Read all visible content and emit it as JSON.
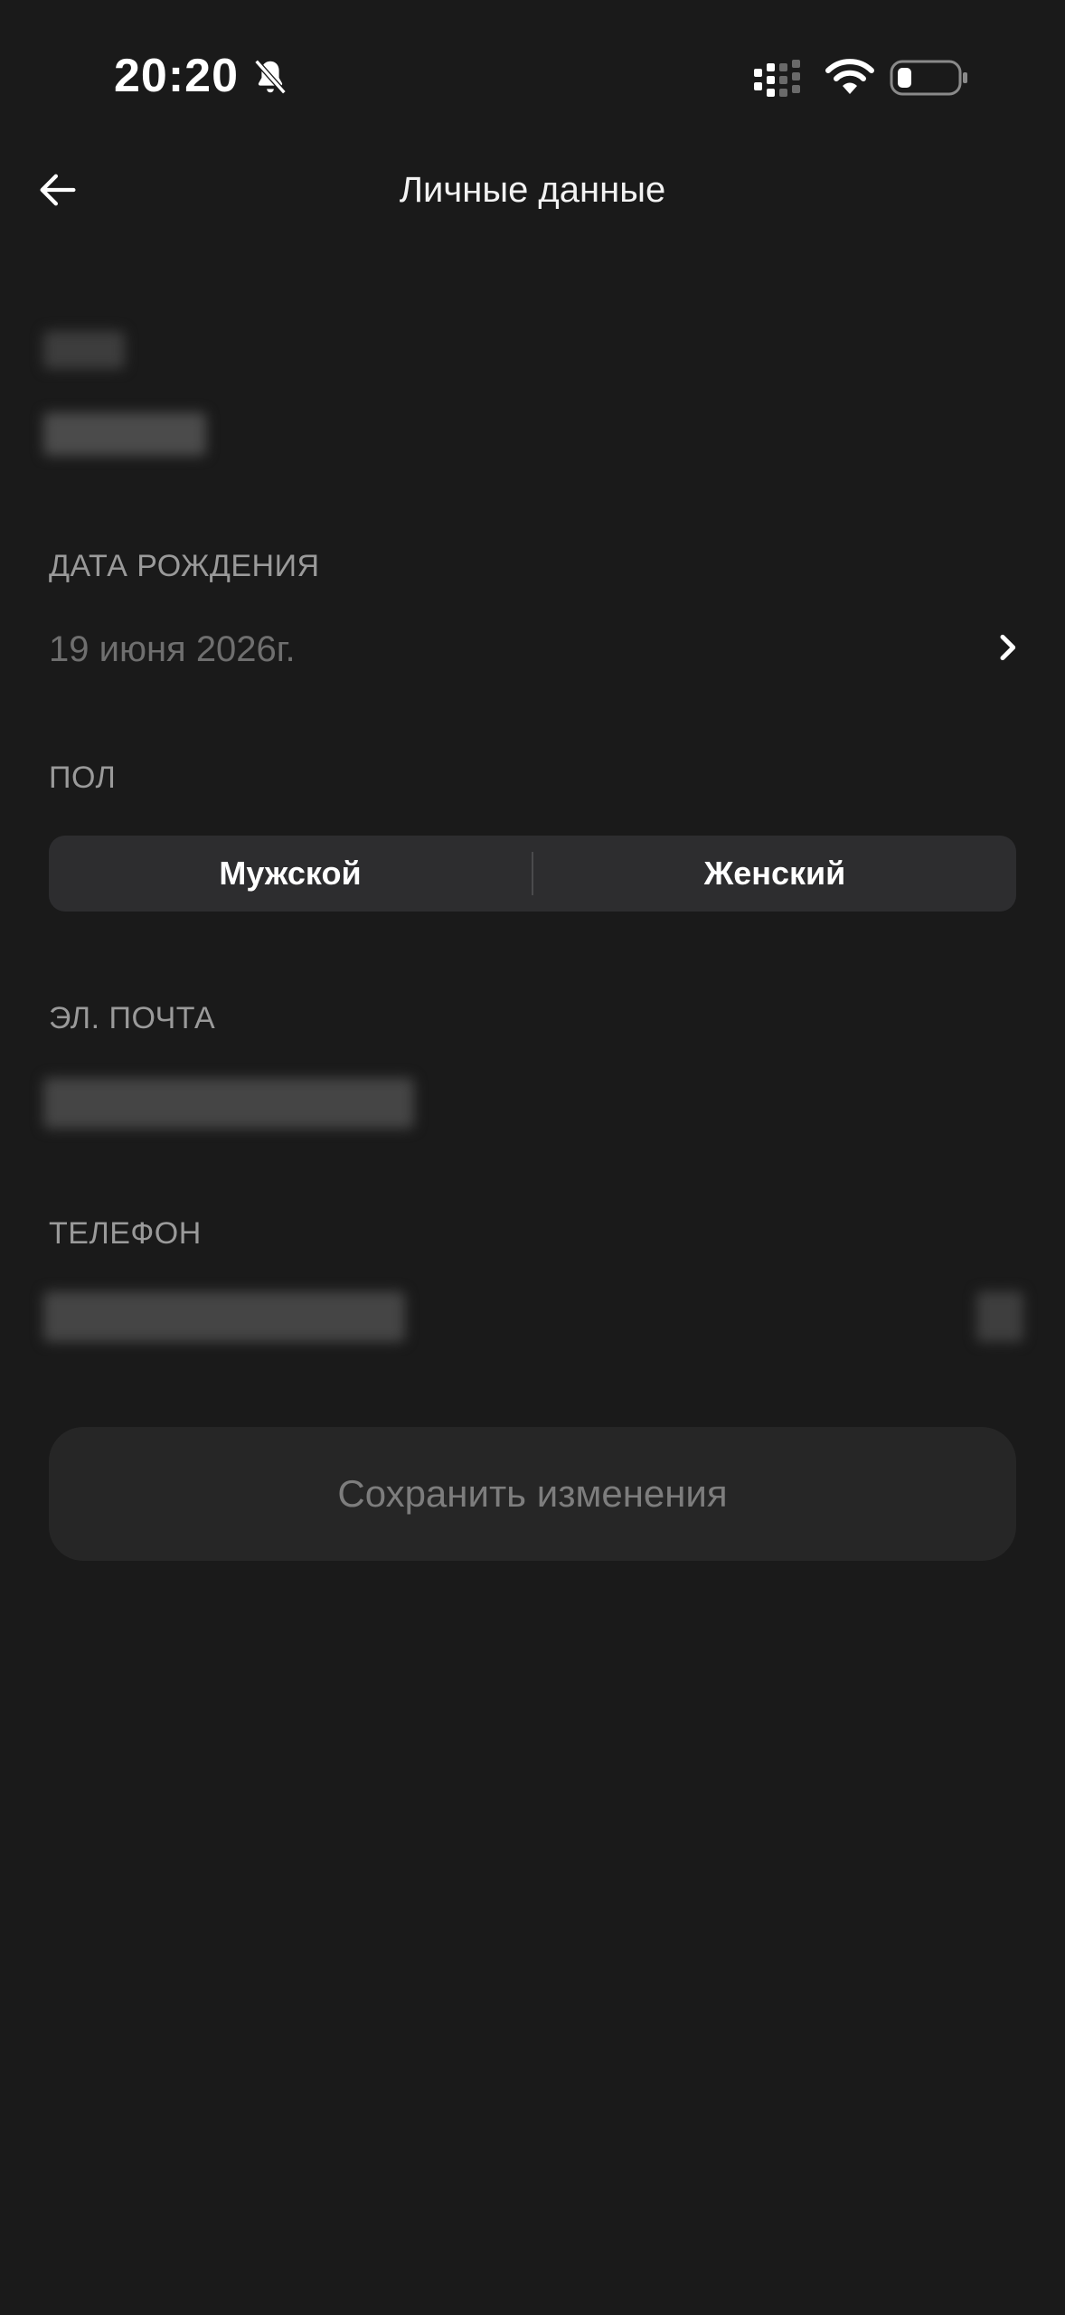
{
  "status_bar": {
    "time": "20:20",
    "icons": [
      "bell-off-icon",
      "signal-icon",
      "wifi-icon",
      "battery-icon"
    ]
  },
  "header": {
    "title": "Личные данные",
    "back_icon": "arrow-left-icon"
  },
  "fields": {
    "birthdate": {
      "label": "ДАТА РОЖДЕНИЯ",
      "value": "19 июня 2026г."
    },
    "gender": {
      "label": "ПОЛ",
      "options": [
        "Мужской",
        "Женский"
      ]
    },
    "email": {
      "label": "ЭЛ. ПОЧТА"
    },
    "phone": {
      "label": "ТЕЛЕФОН"
    }
  },
  "actions": {
    "save_label": "Сохранить изменения"
  },
  "colors": {
    "background": "#1a1a1a",
    "segment_background": "#2d2d2f",
    "button_background": "#262626",
    "label_gray": "#9a9a9a",
    "value_gray": "#6f6f6f"
  }
}
